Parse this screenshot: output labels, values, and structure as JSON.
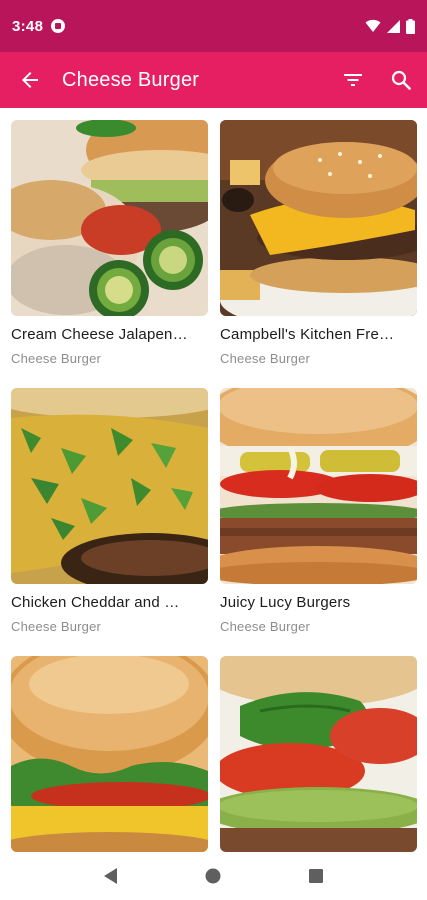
{
  "status": {
    "time": "3:48",
    "icons": [
      "app-notification-icon",
      "wifi-icon",
      "signal-icon",
      "battery-icon"
    ]
  },
  "app_bar": {
    "title": "Cheese Burger",
    "back_icon": "arrow-back-icon",
    "filter_icon": "filter-icon",
    "search_icon": "search-icon"
  },
  "recipes": [
    {
      "title": "Cream Cheese Jalapen…",
      "category": "Cheese Burger"
    },
    {
      "title": "Campbell's Kitchen Fre…",
      "category": "Cheese Burger"
    },
    {
      "title": "Chicken Cheddar and …",
      "category": "Cheese Burger"
    },
    {
      "title": "Juicy Lucy Burgers",
      "category": "Cheese Burger"
    },
    {
      "title": "",
      "category": ""
    },
    {
      "title": "",
      "category": ""
    }
  ],
  "colors": {
    "status_bar": "#b8155a",
    "app_bar": "#e61f63"
  },
  "nav": {
    "icons": [
      "back-triangle-icon",
      "home-circle-icon",
      "recents-square-icon"
    ]
  }
}
